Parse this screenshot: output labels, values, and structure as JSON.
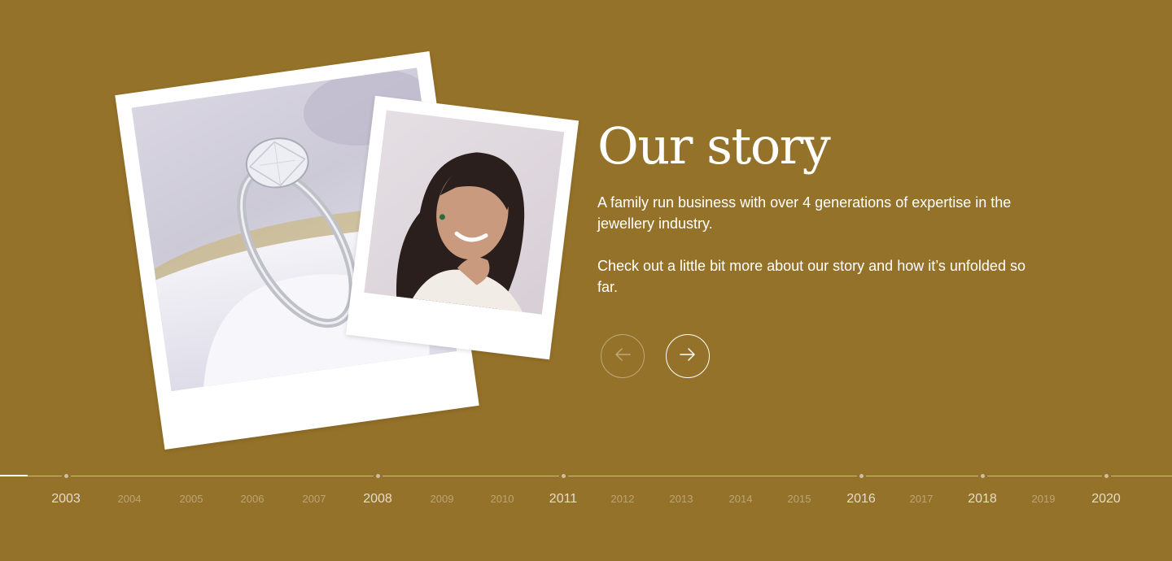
{
  "story": {
    "title": "Our story",
    "paragraph_1": "A family run business with over 4 generations of expertise in the jewellery industry.",
    "paragraph_2": "Check out a little bit more about our story and how it’s unfolded so far."
  },
  "carousel": {
    "prev_icon": "arrow-left-icon",
    "next_icon": "arrow-right-icon",
    "prev_enabled": false,
    "next_enabled": true
  },
  "photos": [
    {
      "subject": "diamond solitaire engagement ring in a white ring box"
    },
    {
      "subject": "smiling woman wearing an emerald stud earring and ring"
    }
  ],
  "timeline": {
    "years": [
      {
        "label": "2003",
        "major": true
      },
      {
        "label": "2004",
        "major": false
      },
      {
        "label": "2005",
        "major": false
      },
      {
        "label": "2006",
        "major": false
      },
      {
        "label": "2007",
        "major": false
      },
      {
        "label": "2008",
        "major": true
      },
      {
        "label": "2009",
        "major": false
      },
      {
        "label": "2010",
        "major": false
      },
      {
        "label": "2011",
        "major": true
      },
      {
        "label": "2012",
        "major": false
      },
      {
        "label": "2013",
        "major": false
      },
      {
        "label": "2014",
        "major": false
      },
      {
        "label": "2015",
        "major": false
      },
      {
        "label": "2016",
        "major": true
      },
      {
        "label": "2017",
        "major": false
      },
      {
        "label": "2018",
        "major": true
      },
      {
        "label": "2019",
        "major": false
      },
      {
        "label": "2020",
        "major": true
      }
    ]
  },
  "colors": {
    "background": "#957229",
    "text": "#ffffff"
  }
}
